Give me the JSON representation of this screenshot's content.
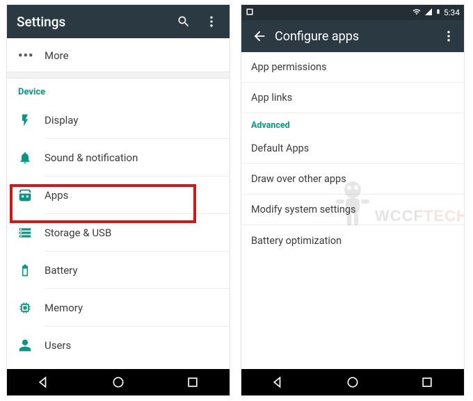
{
  "left": {
    "appbar": {
      "title": "Settings"
    },
    "more_label": "More",
    "section_device": "Device",
    "items": {
      "display": "Display",
      "sound": "Sound & notification",
      "apps": "Apps",
      "storage": "Storage & USB",
      "battery": "Battery",
      "memory": "Memory",
      "users": "Users"
    }
  },
  "right": {
    "status": {
      "time": "5:34"
    },
    "appbar": {
      "title": "Configure apps"
    },
    "rows": {
      "perms": "App permissions",
      "links": "App links",
      "advanced_header": "Advanced",
      "default": "Default Apps",
      "drawover": "Draw over other apps",
      "modify": "Modify system settings",
      "battery": "Battery optimization"
    }
  },
  "watermark": {
    "brand": "WCCF",
    "suffix": "TECH"
  }
}
